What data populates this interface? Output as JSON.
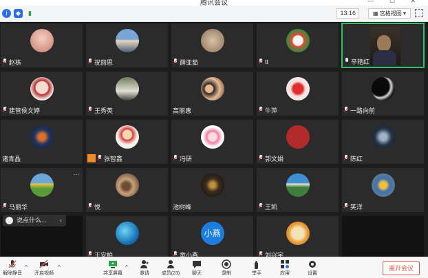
{
  "window": {
    "title": "腾讯会议"
  },
  "toolbar_top": {
    "time": "13:16",
    "view_label": "宫格视图",
    "view_caret": "▾"
  },
  "participants": [
    {
      "name": "赵栋",
      "mic": "muted"
    },
    {
      "name": "祝丽思",
      "mic": "muted"
    },
    {
      "name": "薛亚茹",
      "mic": "muted"
    },
    {
      "name": "tt",
      "mic": "muted"
    },
    {
      "name": "辛艳红",
      "mic": "on",
      "video": true
    },
    {
      "name": "建管侯文婷",
      "mic": "muted"
    },
    {
      "name": "王秀英",
      "mic": "muted"
    },
    {
      "name": "高丽惠",
      "mic": "none"
    },
    {
      "name": "牛萍",
      "mic": "muted"
    },
    {
      "name": "一路向前",
      "mic": "muted"
    },
    {
      "name": "诸青晶",
      "mic": "none"
    },
    {
      "name": "张智鑫",
      "mic": "muted",
      "sharing": true
    },
    {
      "name": "冯研",
      "mic": "muted"
    },
    {
      "name": "郭文娟",
      "mic": "muted"
    },
    {
      "name": "陈红",
      "mic": "muted"
    },
    {
      "name": "马丽华",
      "mic": "muted"
    },
    {
      "name": "悦",
      "mic": "muted"
    },
    {
      "name": "池树峰",
      "mic": "none"
    },
    {
      "name": "王凯",
      "mic": "muted"
    },
    {
      "name": "笑洋",
      "mic": "muted"
    },
    {
      "name": "王安柏",
      "mic": "muted"
    },
    {
      "name": "童小燕",
      "mic": "muted",
      "avatar_text": "小燕"
    },
    {
      "name": "刘兴宇",
      "mic": "muted"
    }
  ],
  "more_icon": "···",
  "chat": {
    "placeholder": "说点什么...",
    "arrow": "‹"
  },
  "bottom_toolbar": {
    "unmute": "解除静音",
    "start_video": "开启视频",
    "share_screen": "共享屏幕",
    "invite": "邀请",
    "members": "成员(23)",
    "chat": "聊天",
    "record": "录制",
    "raise_hand": "举手",
    "apps": "应用",
    "settings": "设置",
    "leave": "离开会议"
  },
  "colors": {
    "active_border": "#2ec167",
    "leave_red": "#e4504f",
    "tile_bg": "#2b2b2b"
  }
}
